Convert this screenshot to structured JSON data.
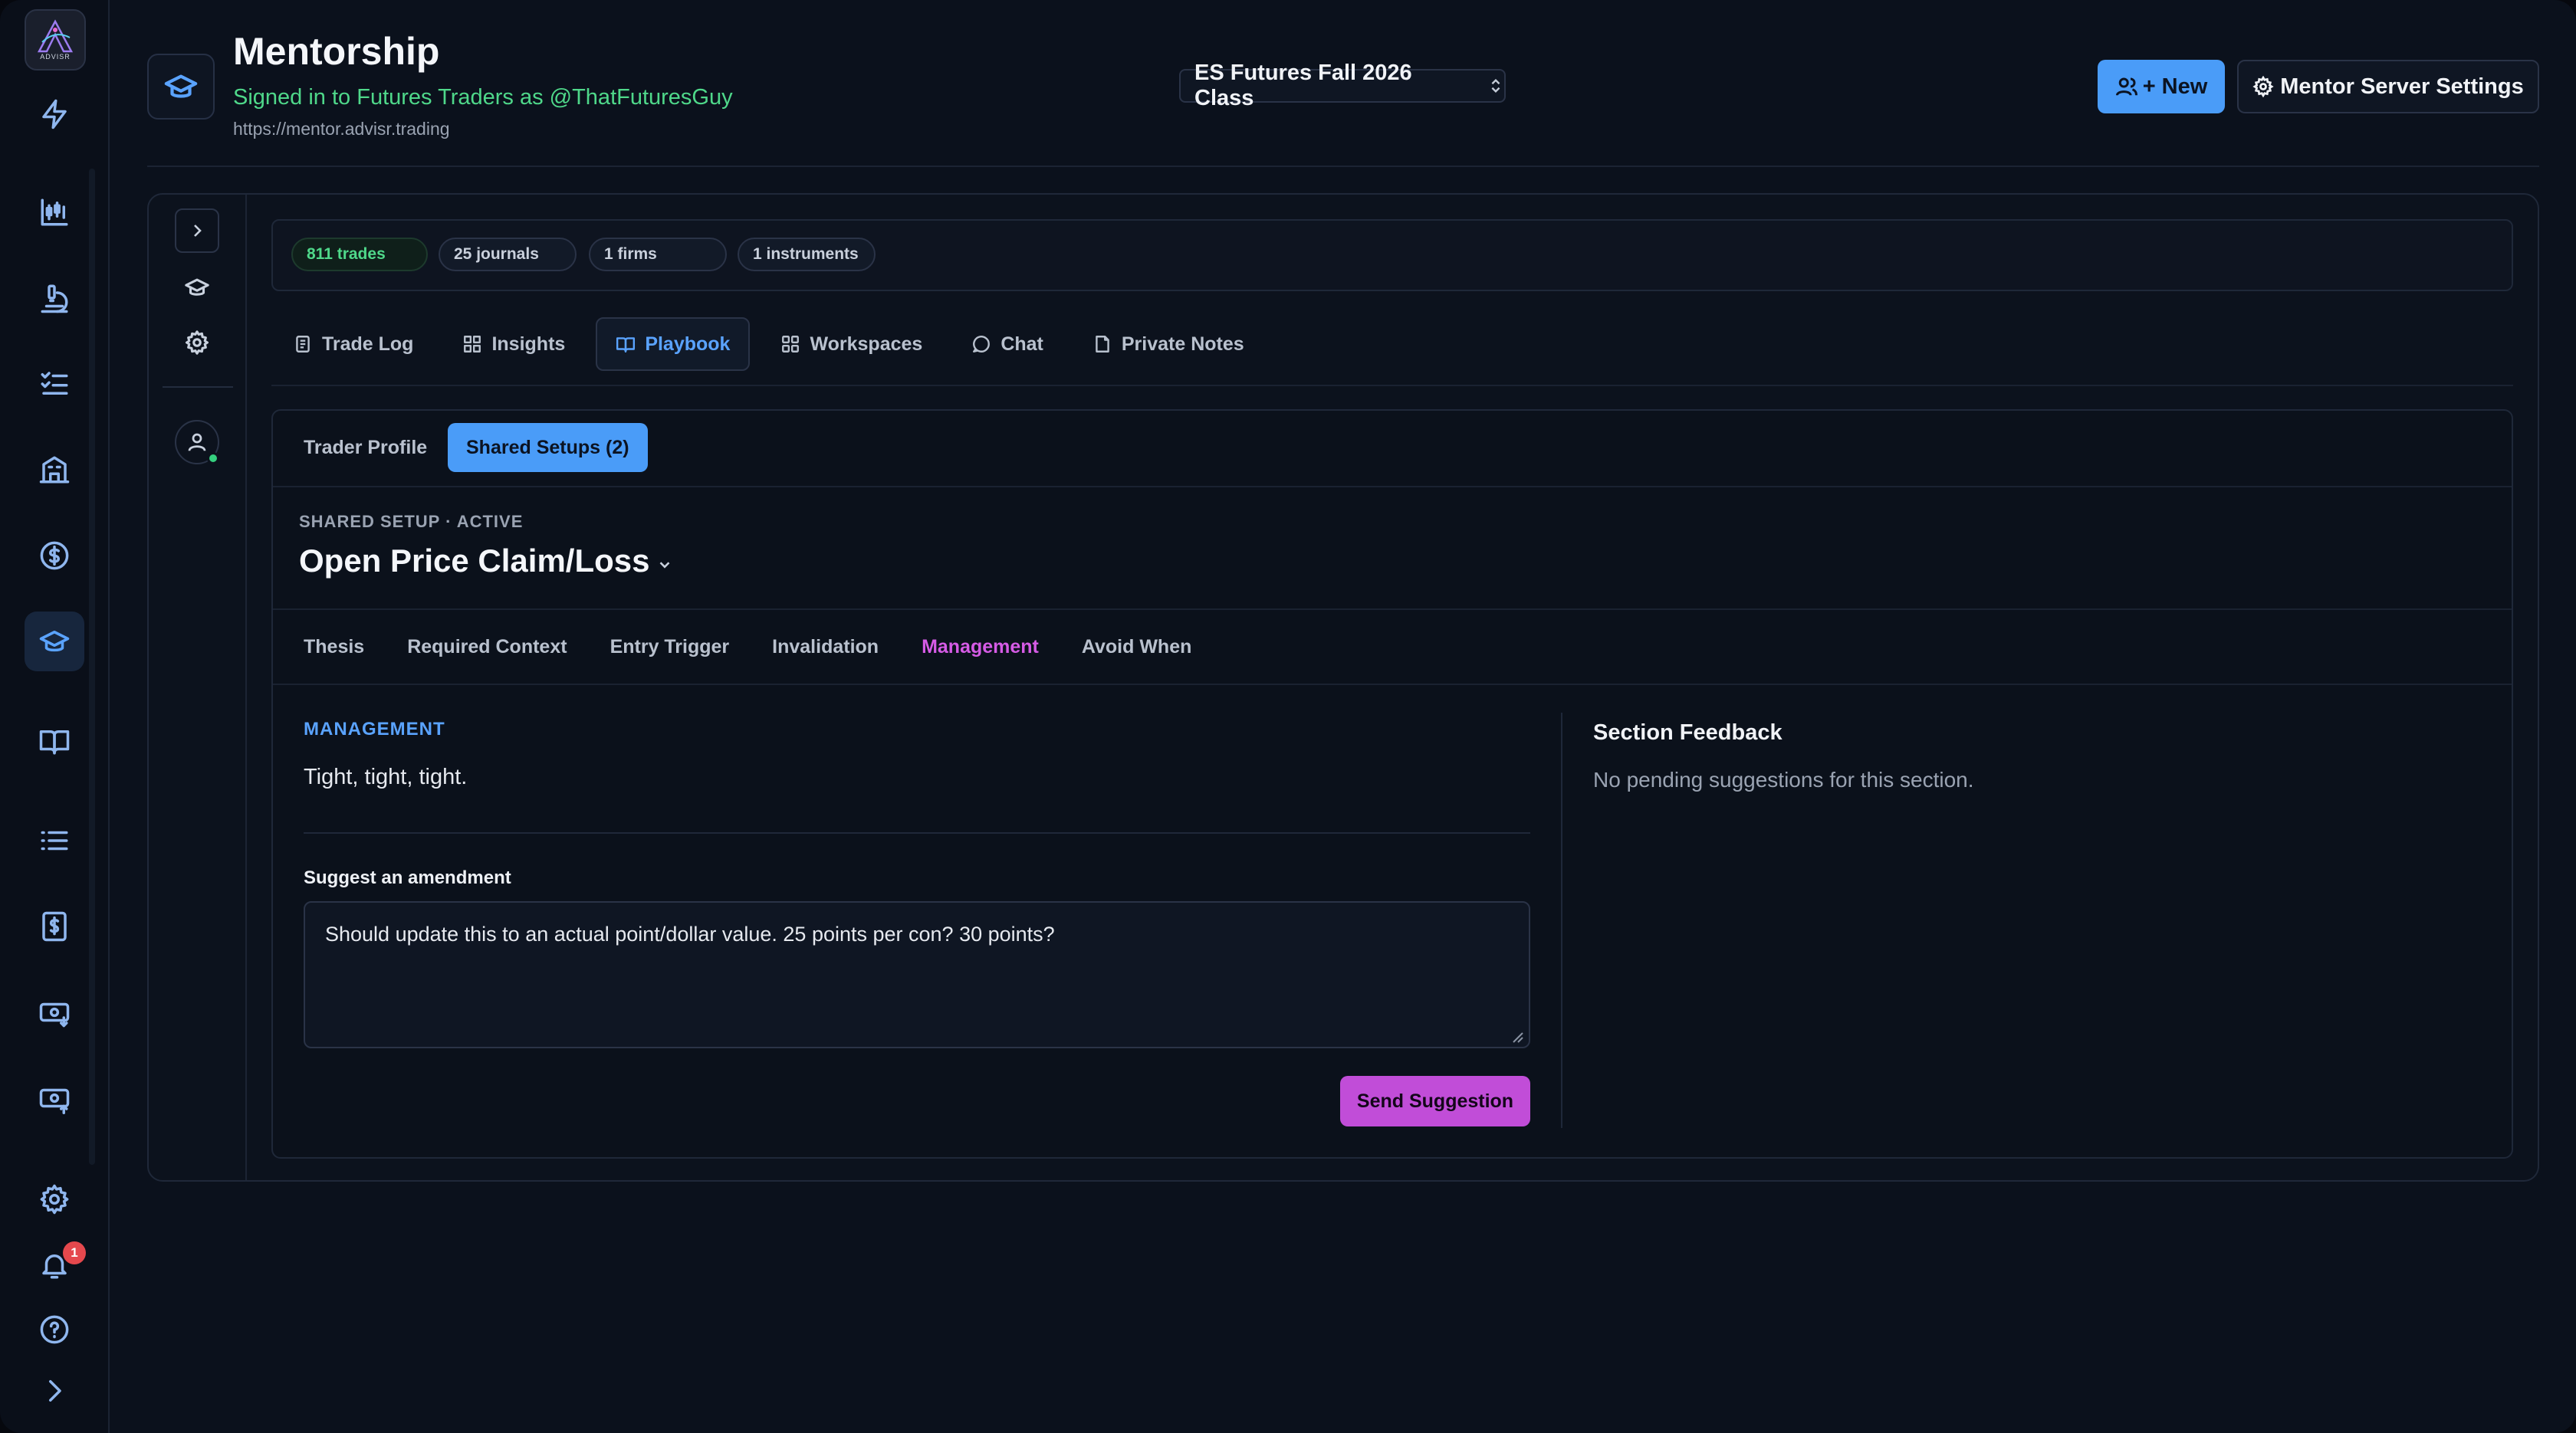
{
  "rail": {
    "logo_text": "ADVISR",
    "items": [
      {
        "icon": "lightning-icon"
      },
      {
        "icon": "candlestick-chart-icon"
      },
      {
        "icon": "microscope-icon"
      },
      {
        "icon": "checklist-icon"
      },
      {
        "icon": "building-icon"
      },
      {
        "icon": "dollar-circle-icon"
      },
      {
        "icon": "graduation-cap-icon",
        "active": true
      },
      {
        "icon": "book-open-icon"
      },
      {
        "icon": "list-icon"
      },
      {
        "icon": "receipt-dollar-icon"
      },
      {
        "icon": "cash-in-icon"
      },
      {
        "icon": "cash-out-icon"
      }
    ],
    "notification_count": "1"
  },
  "header": {
    "title": "Mentorship",
    "signed_in": "Signed in to Futures Traders as @ThatFuturesGuy",
    "url": "https://mentor.advisr.trading",
    "class_select": "ES Futures Fall 2026 Class",
    "new_button": "+ New",
    "settings_button": "Mentor Server Settings"
  },
  "stats": [
    "811 trades",
    "25 journals",
    "1 firms",
    "1 instruments"
  ],
  "tabs": [
    "Trade Log",
    "Insights",
    "Playbook",
    "Workspaces",
    "Chat",
    "Private Notes"
  ],
  "active_tab": "Playbook",
  "subtabs": [
    "Trader Profile",
    "Shared Setups (2)"
  ],
  "setup": {
    "label": "SHARED SETUP · ACTIVE",
    "title": "Open Price Claim/Loss"
  },
  "section_tabs": [
    "Thesis",
    "Required Context",
    "Entry Trigger",
    "Invalidation",
    "Management",
    "Avoid When"
  ],
  "management": {
    "label": "MANAGEMENT",
    "text": "Tight, tight, tight.",
    "amend_label": "Suggest an amendment",
    "amend_value": "Should update this to an actual point/dollar value. 25 points per con? 30 points?",
    "send_button": "Send Suggestion"
  },
  "feedback": {
    "title": "Section Feedback",
    "text": "No pending suggestions for this section."
  },
  "colors": {
    "accent_blue": "#4a9cf8",
    "accent_magenta": "#c14dd8",
    "success_green": "#4fd88a",
    "background": "#0b111c"
  }
}
